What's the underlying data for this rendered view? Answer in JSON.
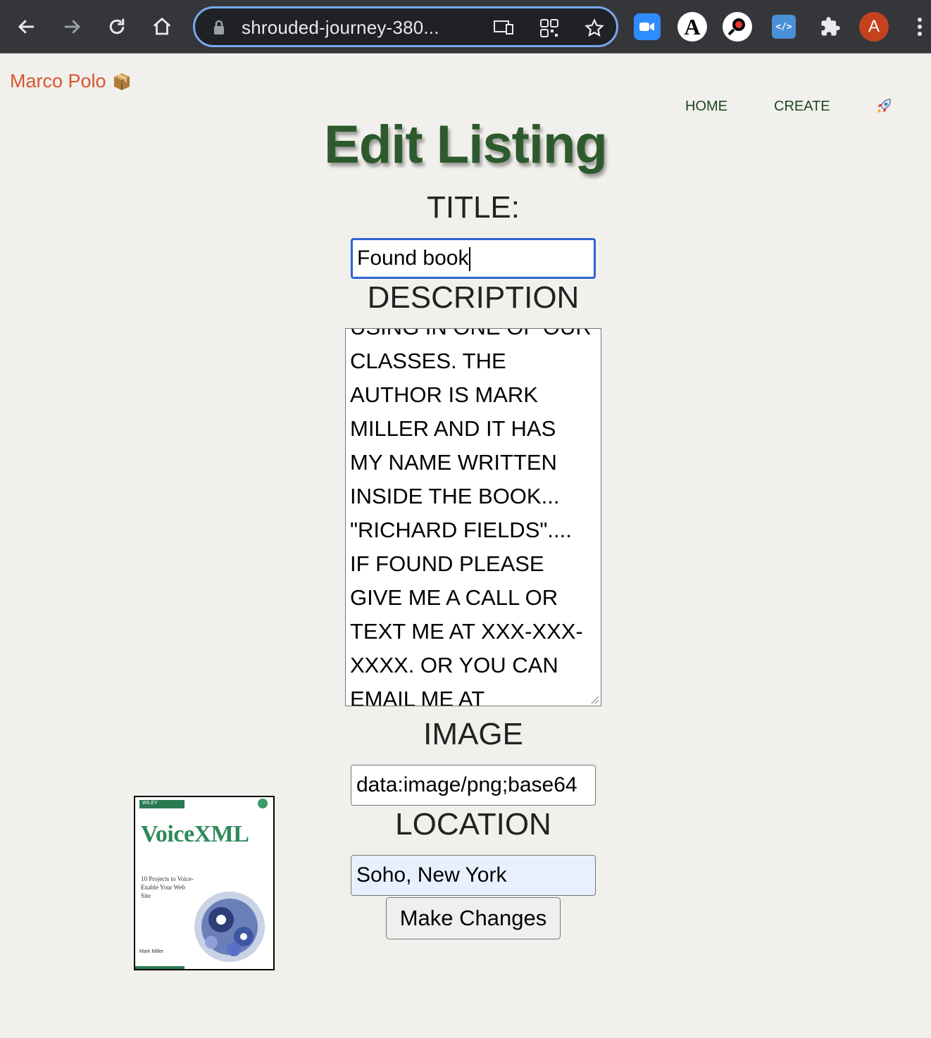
{
  "browser": {
    "url": "shrouded-journey-380...",
    "profile_initial": "A",
    "accent": "#7aa7f1"
  },
  "brand": {
    "name": "Marco Polo",
    "icon": "package-icon"
  },
  "nav": {
    "home": "HOME",
    "create": "CREATE",
    "rocket": "rocket-icon"
  },
  "form": {
    "heading": "Edit Listing",
    "title_label": "TITLE:",
    "title_value": "Found book",
    "description_label": "DESCRIPTION",
    "description_value": "USING IN ONE OF OUR CLASSES. THE AUTHOR IS MARK MILLER AND IT HAS MY NAME WRITTEN INSIDE THE BOOK... \"RICHARD FIELDS\".... IF FOUND PLEASE GIVE ME A CALL OR TEXT ME AT XXX-XXX-XXXX. OR YOU CAN EMAIL ME AT",
    "image_label": "IMAGE",
    "image_value": "data:image/png;base64",
    "location_label": "LOCATION",
    "location_value": "Soho, New York",
    "submit_label": "Make Changes"
  },
  "preview": {
    "title": "VoiceXML",
    "subtitle": "10 Projects to Voice-Enable Your Web Site",
    "publisher": "WILEY",
    "author": "Mark Miller"
  },
  "colors": {
    "brand": "#d9542f",
    "heading": "#2d5a2d",
    "nav": "#1e4620",
    "background": "#f1f0ec"
  }
}
